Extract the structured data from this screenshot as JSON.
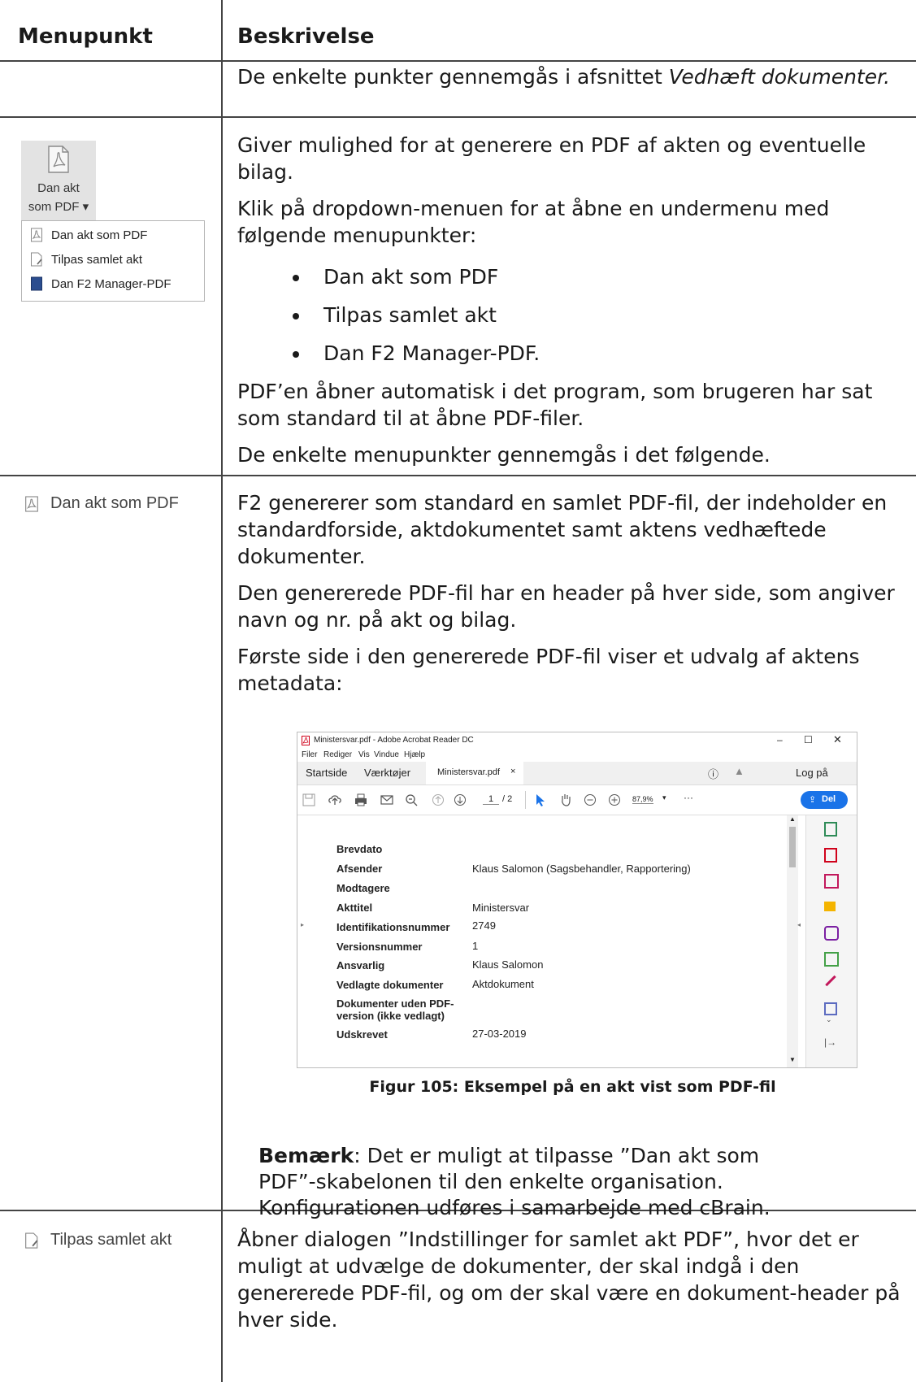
{
  "header": {
    "col1": "Menupunkt",
    "col2": "Beskrivelse"
  },
  "row1": {
    "text": "De enkelte punkter gennemgås i afsnittet ",
    "italic": "Vedhæft dokumenter."
  },
  "row2": {
    "button_label_1": "Dan akt",
    "button_label_2": "som PDF",
    "dropdown_arrow": "▾",
    "menu_items": [
      "Dan akt som PDF",
      "Tilpas samlet akt",
      "Dan F2 Manager-PDF"
    ],
    "p1": "Giver mulighed for at generere en PDF af akten og eventuelle bilag.",
    "p2": "Klik på dropdown-menuen for at åbne en undermenu med følgende menupunkter:",
    "bullets": [
      "Dan akt som PDF",
      "Tilpas samlet akt",
      "Dan F2 Manager-PDF."
    ],
    "p3": "PDF’en åbner automatisk i det program, som brugeren har sat som standard til at åbne PDF-filer.",
    "p4": "De enkelte menupunkter gennemgås i det følgende."
  },
  "row3": {
    "label": "Dan akt som PDF",
    "p1": "F2 genererer som standard en samlet PDF-fil, der indeholder en standardforside, aktdokumentet samt aktens vedhæftede dokumenter.",
    "p2": "Den genererede PDF-fil har en header på hver side, som angiver navn og nr. på akt og bilag.",
    "p3": "Første side i den genererede PDF-fil viser et udvalg af aktens metadata:",
    "screenshot": {
      "window_title": "Ministersvar.pdf - Adobe Acrobat Reader DC",
      "menu": [
        "Filer",
        "Rediger",
        "Vis",
        "Vindue",
        "Hjælp"
      ],
      "tabs": [
        "Startside",
        "Værktøjer",
        "Ministersvar.pdf"
      ],
      "tab_close": "×",
      "login": "Log på",
      "page_current": "1",
      "page_total": "/ 2",
      "zoom": "87,9%",
      "share": "Del",
      "fields": [
        {
          "k": "Brevdato",
          "v": ""
        },
        {
          "k": "Afsender",
          "v": "Klaus Salomon (Sagsbehandler, Rapportering)"
        },
        {
          "k": "Modtagere",
          "v": ""
        },
        {
          "k": "Akttitel",
          "v": "Ministersvar"
        },
        {
          "k": "Identifikationsnummer",
          "v": "2749"
        },
        {
          "k": "Versionsnummer",
          "v": "1"
        },
        {
          "k": "Ansvarlig",
          "v": "Klaus Salomon"
        },
        {
          "k": "Vedlagte dokumenter",
          "v": "Aktdokument"
        },
        {
          "k": "Dokumenter uden PDF-",
          "v": ""
        },
        {
          "k": "version (ikke vedlagt)",
          "v": ""
        },
        {
          "k": "Udskrevet",
          "v": "27-03-2019"
        }
      ]
    },
    "caption": "Figur 105: Eksempel på en akt vist som PDF-fil",
    "note_bold": "Bemærk",
    "note_line1": ": Det er muligt at tilpasse ”Dan akt som",
    "note_line2": "PDF”-skabelonen til den enkelte organisation.",
    "note_line3": "Konfigurationen udføres i samarbejde med cBrain."
  },
  "row4": {
    "label": "Tilpas samlet akt",
    "p1": "Åbner dialogen ”Indstillinger for samlet akt PDF”, hvor det er muligt at udvælge de dokumenter, der skal indgå i den genererede PDF-fil, og om der skal være en dokument-header på hver side."
  }
}
